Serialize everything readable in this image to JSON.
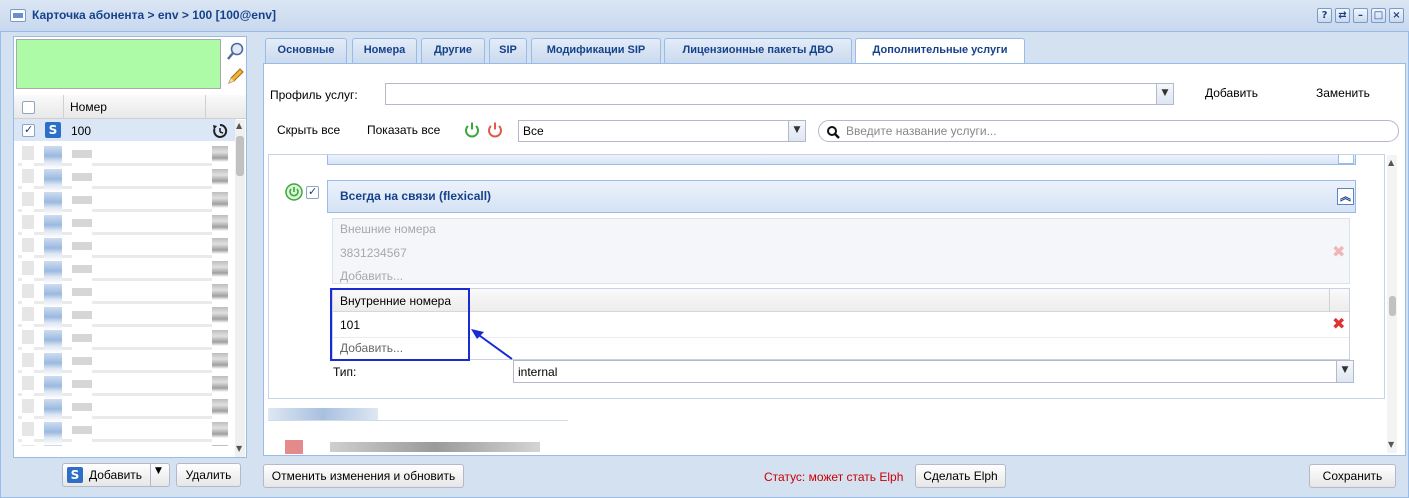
{
  "window": {
    "title": "Карточка абонента > env > 100 [100@env]",
    "tools": [
      "?",
      "⇄",
      "–",
      "□",
      "×"
    ]
  },
  "left": {
    "column_header": "Номер",
    "first_row_number": "100",
    "add_button": "Добавить",
    "delete_button": "Удалить"
  },
  "tabs": [
    {
      "label": "Основные"
    },
    {
      "label": "Номера"
    },
    {
      "label": "Другие"
    },
    {
      "label": "SIP"
    },
    {
      "label": "Модификации SIP"
    },
    {
      "label": "Лицензионные пакеты ДВО"
    },
    {
      "label": "Дополнительные услуги"
    }
  ],
  "main": {
    "profile_label": "Профиль услуг:",
    "profile_value": "",
    "add_label": "Добавить",
    "replace_label": "Заменить",
    "collapse_all": "Скрыть все",
    "expand_all": "Показать все",
    "filter_value": "Все",
    "search_placeholder": "Введите название услуги..."
  },
  "service": {
    "title": "Всегда на связи (flexicall)",
    "external": {
      "header": "Внешние номера",
      "value": "3831234567",
      "add": "Добавить..."
    },
    "internal": {
      "header": "Внутренние номера",
      "value": "101",
      "add": "Добавить..."
    },
    "type_label": "Тип:",
    "type_value": "internal"
  },
  "footer": {
    "cancel_refresh": "Отменить изменения и обновить",
    "status": "Статус: может стать Elph",
    "make_elph": "Сделать Elph",
    "save": "Сохранить"
  },
  "colors": {
    "accent": "#15428b",
    "highlight_frame": "#1a2bd4",
    "status_text": "#cc0000",
    "green_area": "#adfba7"
  }
}
